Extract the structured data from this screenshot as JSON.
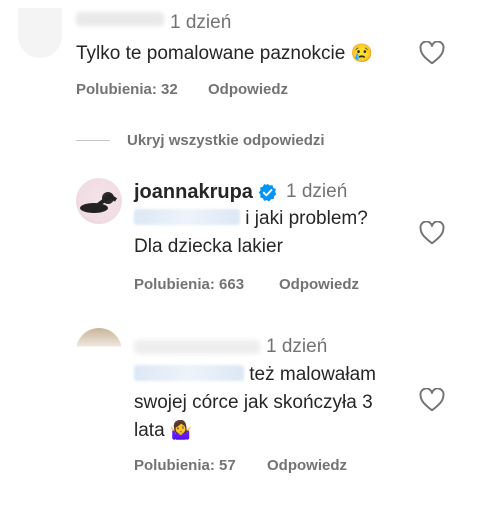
{
  "comments": [
    {
      "time": "1 dzień",
      "text": "Tylko te pomalowane paznokcie",
      "emoji": "😢",
      "likes": "Polubienia: 32",
      "reply": "Odpowiedz"
    }
  ],
  "replies_toggle": "Ukryj wszystkie odpowiedzi",
  "replies": [
    {
      "username": "joannakrupa",
      "verified": true,
      "time": "1 dzień",
      "mention_text": "i jaki problem?",
      "line2": "Dla dziecka lakier",
      "likes": "Polubienia: 663",
      "reply": "Odpowiedz"
    },
    {
      "time": "1 dzień",
      "mention_text": "też malowałam",
      "line2": "swojej córce jak skończyła 3",
      "line3": "lata",
      "emoji": "🤷‍♀️",
      "likes": "Polubienia: 57",
      "reply": "Odpowiedz"
    }
  ],
  "colors": {
    "text": "#262626",
    "secondary": "#737373",
    "verified": "#0095f6",
    "mention": "#00376b"
  }
}
